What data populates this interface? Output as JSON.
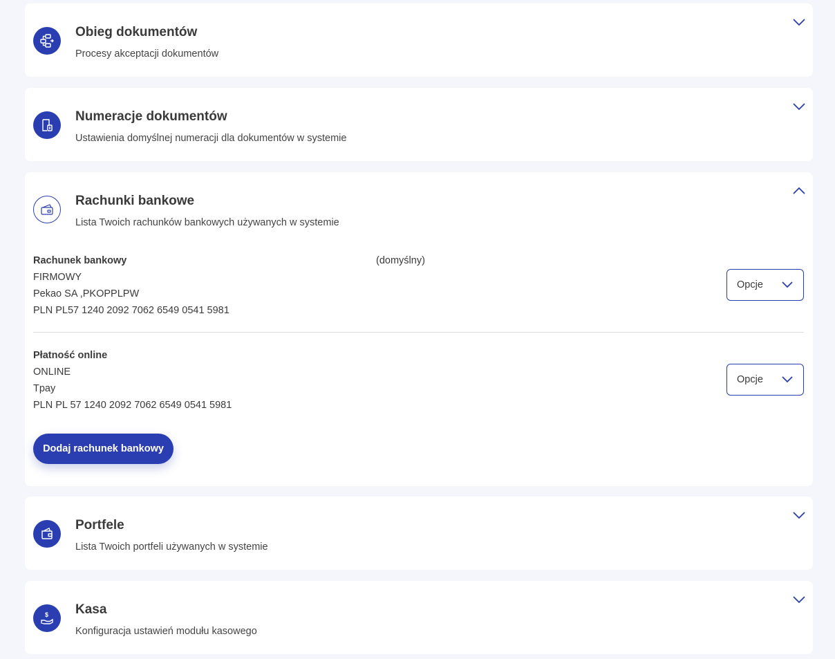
{
  "sections": {
    "obieg": {
      "title": "Obieg dokumentów",
      "subtitle": "Procesy akceptacji dokumentów",
      "icon": "workflow-icon"
    },
    "numeracje": {
      "title": "Numeracje dokumentów",
      "subtitle": "Ustawienia domyślnej numeracji dla dokumentów w systemie",
      "icon": "document-numbering-icon"
    },
    "rachunki": {
      "title": "Rachunki bankowe",
      "subtitle": "Lista Twoich rachunków bankowych używanych w systemie",
      "icon": "bank-card-icon",
      "expanded": true,
      "accounts": [
        {
          "name": "Rachunek bankowy",
          "default_label": "(domyślny)",
          "type": "FIRMOWY",
          "bank": "Pekao SA ,PKOPPLPW",
          "number": "PLN PL57 1240 2092 7062 6549 0541 5981",
          "options_label": "Opcje"
        },
        {
          "name": "Płatność online",
          "type": "ONLINE",
          "bank": "Tpay",
          "number": "PLN PL 57 1240 2092 7062 6549 0541 5981",
          "options_label": "Opcje"
        }
      ],
      "add_button_label": "Dodaj rachunek bankowy"
    },
    "portfele": {
      "title": "Portfele",
      "subtitle": "Lista Twoich portfeli używanych w systemie",
      "icon": "wallet-icon"
    },
    "kasa": {
      "title": "Kasa",
      "subtitle": "Konfiguracja ustawień modułu kasowego",
      "icon": "cash-hand-icon"
    }
  },
  "colors": {
    "accent": "#2a3eb1",
    "background": "#f4f6fb",
    "card": "#ffffff",
    "text": "#3a3a3a"
  }
}
